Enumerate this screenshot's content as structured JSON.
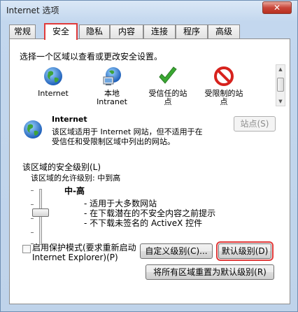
{
  "window": {
    "title": "Internet 选项",
    "close_label": "✕"
  },
  "tabs": [
    {
      "label": "常规"
    },
    {
      "label": "安全"
    },
    {
      "label": "隐私"
    },
    {
      "label": "内容"
    },
    {
      "label": "连接"
    },
    {
      "label": "程序"
    },
    {
      "label": "高级"
    }
  ],
  "active_tab": "安全",
  "security": {
    "instruction": "选择一个区域以查看或更改安全设置。",
    "zones": [
      {
        "label": "Internet",
        "icon": "globe-icon"
      },
      {
        "label": "本地\nIntranet",
        "icon": "intranet-icon"
      },
      {
        "label": "受信任的站\n点",
        "icon": "checkmark-icon"
      },
      {
        "label": "受限制的站\n点",
        "icon": "no-entry-icon"
      }
    ],
    "selected_zone": {
      "name": "Internet",
      "description": "该区域适用于 Internet 网站，但不适用于在\n受信任和受限制区域中列出的网站。",
      "sites_button": "站点(S)"
    },
    "level_group": {
      "title": "该区域的安全级别(L)",
      "allowed_text": "该区域的允许级别: 中到高",
      "level_name": "中-高",
      "bullets": [
        "- 适用于大多数网站",
        "- 在下载潜在的不安全内容之前提示",
        "- 不下载未签名的 ActiveX 控件"
      ],
      "slider_level_fraction": 0.35
    },
    "protected_mode": {
      "label": "启用保护模式(要求重新启动\nInternet Explorer)(P)",
      "checked": false
    },
    "buttons": {
      "custom_level": "自定义级别(C)...",
      "default_level": "默认级别(D)",
      "reset_all": "将所有区域重置为默认级别(R)"
    }
  },
  "colors": {
    "highlight": "#e03a3a",
    "accent": "#2a6fd6"
  }
}
